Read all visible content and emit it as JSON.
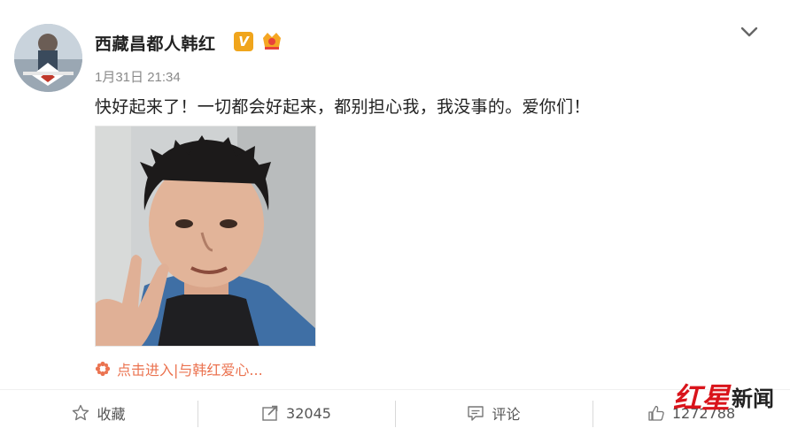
{
  "post": {
    "user": {
      "name": "西藏昌都人韩红",
      "verified_label": "V",
      "avatar": "avatar-image"
    },
    "timestamp": "1月31日 21:34",
    "content": "快好起来了！一切都会好起来，都别担心我，我没事的。爱你们！",
    "image": "photo-selfie",
    "topic_link": "点击进入|与韩红爱心..."
  },
  "actions": {
    "favorite_label": "收藏",
    "repost_count": "32045",
    "comment_label": "评论",
    "like_count": "1272788"
  },
  "watermark": {
    "red": "红星",
    "black": "新闻"
  },
  "icons": {
    "more": "chevron-down-icon",
    "favorite": "star-icon",
    "repost": "share-icon",
    "comment": "comment-icon",
    "like": "thumbs-up-icon"
  },
  "colors": {
    "link": "#eb7350",
    "badge": "#f0a51c",
    "watermark": "#d9141b"
  }
}
